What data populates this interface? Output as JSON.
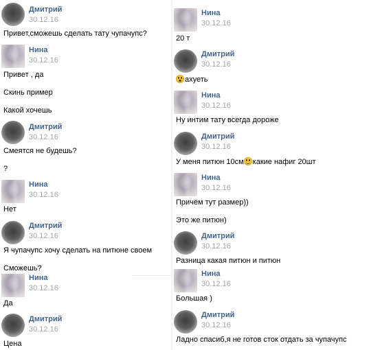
{
  "left": {
    "messages": [
      {
        "avatar": "dmitry",
        "name": "Дмитрий",
        "date": "30.12.16",
        "lines": [
          "Привет,сможешь сделать тату чупачупс?"
        ]
      },
      {
        "avatar": "nina",
        "name": "Нина",
        "date": "30.12.16",
        "lines": [
          "Привет , да",
          "Скинь пример",
          "Какой хочешь"
        ]
      },
      {
        "avatar": "dmitry",
        "name": "Дмитрий",
        "date": "30.12.16",
        "lines": [
          "Смеятся не будешь?",
          "?"
        ]
      },
      {
        "avatar": "nina",
        "name": "Нина",
        "date": "30.12.16",
        "lines": [
          "Нет"
        ]
      },
      {
        "avatar": "dmitry",
        "name": "Дмитрий",
        "date": "30.12.16",
        "lines": [
          "Я чупачупс хочу сделать на питюне своем",
          "Сможешь?"
        ]
      },
      {
        "avatar": "nina",
        "name": "Нина",
        "date": "30.12.16",
        "lines": [
          "Да"
        ]
      },
      {
        "avatar": "dmitry",
        "name": "Дмитрий",
        "date": "30.12.16",
        "lines": [
          "Цена"
        ]
      }
    ]
  },
  "right": {
    "messages": [
      {
        "avatar": "nina",
        "name": "Нина",
        "date": "30.12.16",
        "lines": [
          "20 т"
        ]
      },
      {
        "avatar": "dmitry",
        "name": "Дмитрий",
        "date": "30.12.16",
        "lines": [
          "ахуеть"
        ],
        "emoji": "shocked-face-icon"
      },
      {
        "avatar": "nina",
        "name": "Нина",
        "date": "30.12.16",
        "lines": [
          "Ну интим тату всегда дороже"
        ]
      },
      {
        "avatar": "dmitry",
        "name": "Дмитрий",
        "date": "30.12.16",
        "lines": [
          "У меня питюн 10см",
          "какие нафиг 20шт"
        ],
        "emoji": "smiling-face-icon"
      },
      {
        "avatar": "nina",
        "name": "Нина",
        "date": "30.12.16",
        "lines": [
          "Причём тут размер))",
          "Это же питюн)"
        ]
      },
      {
        "avatar": "dmitry",
        "name": "Дмитрий",
        "date": "30.12.16",
        "lines": [
          "Разница какая питюн и питюн"
        ]
      },
      {
        "avatar": "nina",
        "name": "Нина",
        "date": "30.12.16",
        "lines": [
          "Большая )"
        ]
      },
      {
        "avatar": "dmitry",
        "name": "Дмитрий",
        "date": "30.12.16",
        "lines": [
          "Ладно спасиб,я не готов сток отдать за чупачупс"
        ]
      }
    ]
  }
}
